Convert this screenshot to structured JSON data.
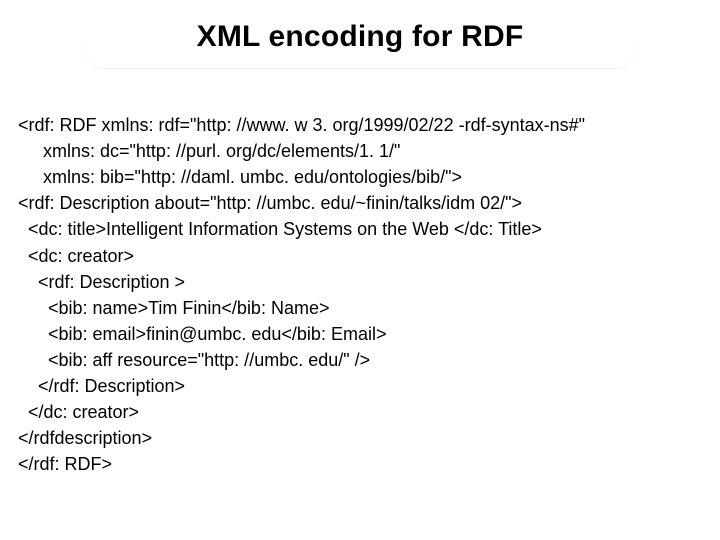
{
  "title": "XML encoding for RDF",
  "code": {
    "l01": "<rdf: RDF xmlns: rdf=\"http: //www. w 3. org/1999/02/22 -rdf-syntax-ns#\"",
    "l02": "     xmlns: dc=\"http: //purl. org/dc/elements/1. 1/\"",
    "l03": "     xmlns: bib=\"http: //daml. umbc. edu/ontologies/bib/\">",
    "l04": "<rdf: Description about=\"http: //umbc. edu/~finin/talks/idm 02/\">",
    "l05": "  <dc: title>Intelligent Information Systems on the Web </dc: Title>",
    "l06": "  <dc: creator>",
    "l07": "    <rdf: Description >",
    "l08": "      <bib: name>Tim Finin</bib: Name>",
    "l09": "      <bib: email>finin@umbc. edu</bib: Email>",
    "l10": "      <bib: aff resource=\"http: //umbc. edu/\" />",
    "l11": "    </rdf: Description>",
    "l12": "  </dc: creator>",
    "l13": "</rdfdescription>",
    "l14": "</rdf: RDF>"
  }
}
